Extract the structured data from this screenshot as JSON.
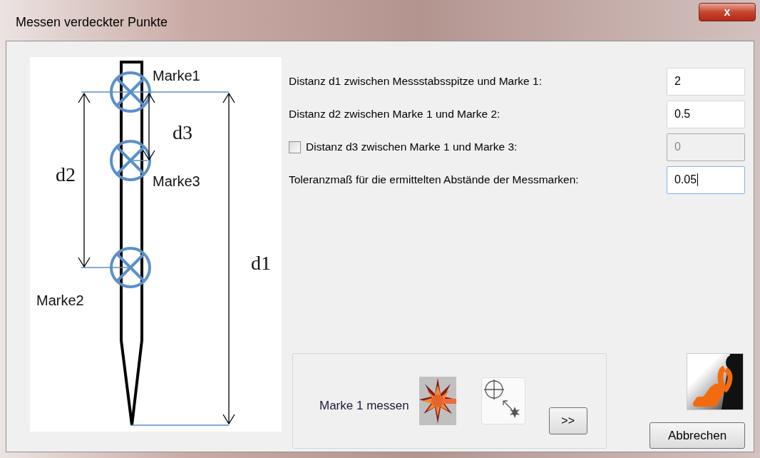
{
  "window": {
    "title": "Messen verdeckter Punkte",
    "close": "x"
  },
  "diagram": {
    "labels": [
      "Marke1",
      "Marke3",
      "Marke2",
      "d3",
      "d2",
      "d1"
    ]
  },
  "fields": [
    {
      "kind": "text",
      "label": "Distanz d1 zwischen Messstabsspitze und Marke 1:",
      "value": "2",
      "disabled": false,
      "focused": false
    },
    {
      "kind": "text",
      "label": "Distanz d2 zwischen Marke 1 und Marke 2:",
      "value": "0.5",
      "disabled": false,
      "focused": false
    },
    {
      "kind": "checkbox",
      "checked": false,
      "label": "Distanz d3 zwischen Marke 1 und Marke 3:",
      "value": "0",
      "disabled": true,
      "focused": false
    },
    {
      "kind": "text",
      "label": "Toleranzmaß für die ermittelten Abstände der Messmarken:",
      "value": "0.05",
      "disabled": false,
      "focused": true
    }
  ],
  "measure": {
    "label": "Marke 1 messen",
    "next_button": ">>"
  },
  "cancel_button": "Abbrechen"
}
